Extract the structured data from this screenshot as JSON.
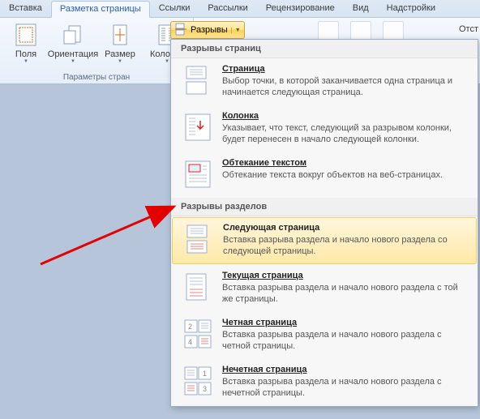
{
  "tabs": {
    "insert": "Вставка",
    "pagelayout": "Разметка страницы",
    "links": "Ссылки",
    "mailings": "Рассылки",
    "review": "Рецензирование",
    "view": "Вид",
    "addins": "Надстройки"
  },
  "ribbon": {
    "margins": "Поля",
    "orientation": "Ориентация",
    "size": "Размер",
    "columns": "Колонки",
    "group_page_setup": "Параметры стран",
    "breaks_button": "Разрывы",
    "indent_label": "Отст"
  },
  "panel": {
    "section_page_breaks": "Разрывы страниц",
    "section_section_breaks": "Разрывы разделов",
    "page": {
      "title": "Страница",
      "desc": "Выбор точки, в которой заканчивается одна страница и начинается следующая страница."
    },
    "column": {
      "title": "Колонка",
      "desc": "Указывает, что текст, следующий за разрывом колонки, будет перенесен в начало следующей колонки."
    },
    "textwrap": {
      "title": "Обтекание текстом",
      "desc": "Обтекание текста вокруг объектов на веб-страницах."
    },
    "nextpage": {
      "title": "Следующая страница",
      "desc": "Вставка разрыва раздела и начало нового раздела со следующей страницы."
    },
    "continuous": {
      "title": "Текущая страница",
      "desc": "Вставка разрыва раздела и начало нового раздела с той же страницы."
    },
    "evenpage": {
      "title": "Четная страница",
      "desc": "Вставка разрыва раздела и начало нового раздела с четной страницы."
    },
    "oddpage": {
      "title": "Нечетная страница",
      "desc": "Вставка разрыва раздела и начало нового раздела с нечетной страницы."
    }
  }
}
